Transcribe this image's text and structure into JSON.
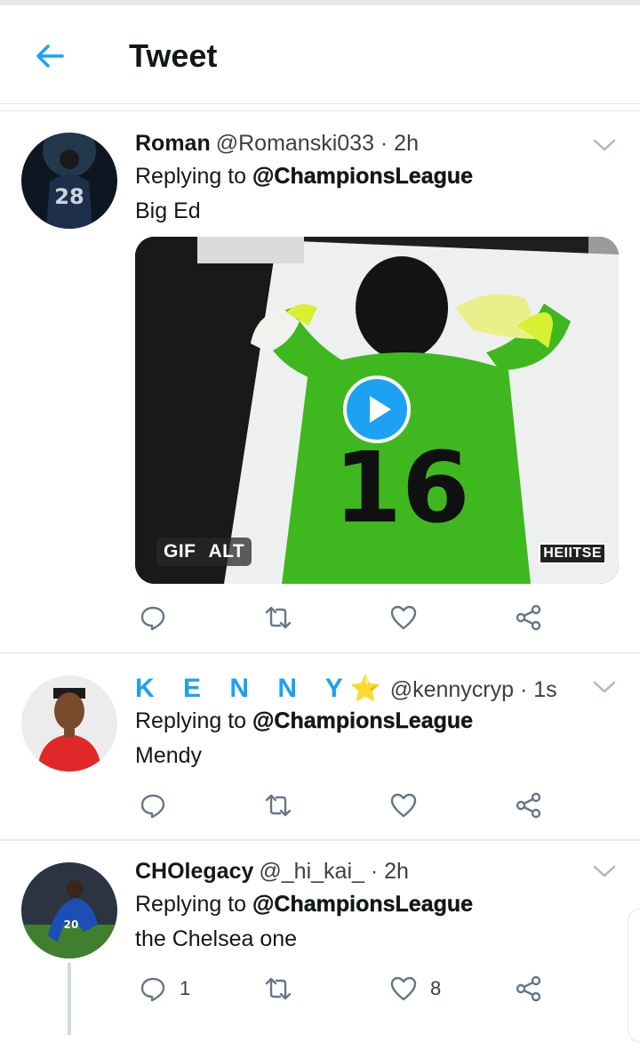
{
  "header": {
    "title": "Tweet",
    "back_icon": "arrow-left-icon"
  },
  "tweets": [
    {
      "name": "Roman",
      "handle": "@Romanski033 · 2h",
      "replying_prefix": "Replying to",
      "mention": "@ChampionsLeague",
      "text": "Big Ed",
      "media": {
        "type": "GIF",
        "gif_label": "GIF",
        "alt_label": "ALT",
        "jersey_number": "16",
        "watermark": "HEIITSE"
      },
      "actions": {
        "reply_count": "",
        "like_count": ""
      }
    },
    {
      "name": "K E N N Y",
      "name_emoji": "⭐",
      "handle": "@kennycryp · 1s",
      "replying_prefix": "Replying to",
      "mention": "@ChampionsLeague",
      "text": "Mendy",
      "actions": {
        "reply_count": "",
        "like_count": ""
      }
    },
    {
      "name": "CHOlegacy",
      "handle": "@_hi_kai_ · 2h",
      "replying_prefix": "Replying to",
      "mention": "@ChampionsLeague",
      "text": "the Chelsea one",
      "actions": {
        "reply_count": "1",
        "like_count": "8"
      }
    }
  ],
  "avatars": {
    "roman_jersey": "28",
    "cholegacy_jersey": "20"
  },
  "colors": {
    "accent": "#1da1f2",
    "text": "#14171a",
    "secondary": "#3c4043",
    "icon": "#657786"
  }
}
